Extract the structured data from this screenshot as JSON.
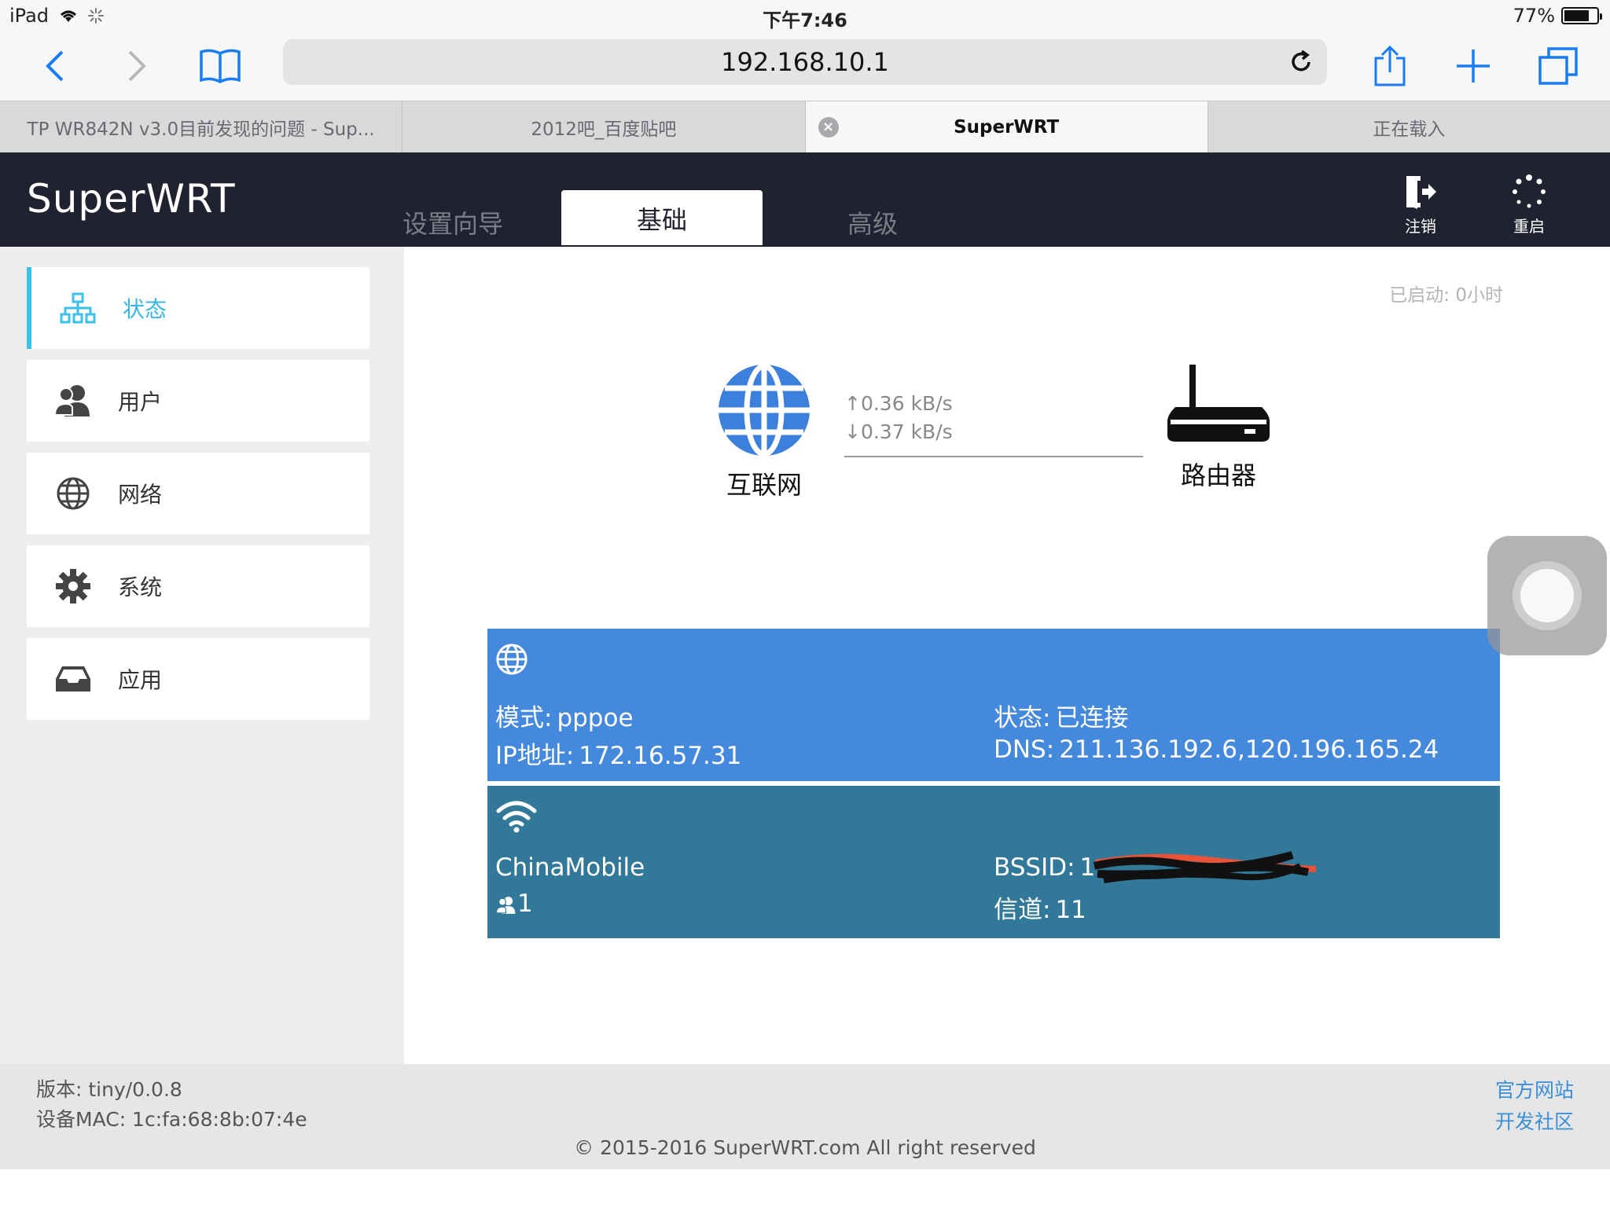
{
  "status_bar": {
    "device": "iPad",
    "time": "下午7:46",
    "battery": "77%",
    "battery_level": 0.77
  },
  "toolbar": {
    "url": "192.168.10.1"
  },
  "tabs": [
    {
      "label": "TP WR842N v3.0目前发现的问题 - Sup..."
    },
    {
      "label": "2012吧_百度贴吧"
    },
    {
      "label": "SuperWRT",
      "active": true
    },
    {
      "label": "正在载入"
    }
  ],
  "header": {
    "brand": "SuperWRT",
    "nav": [
      "设置向导",
      "基础",
      "高级"
    ],
    "logout": "注销",
    "reboot": "重启"
  },
  "sidebar": {
    "items": [
      {
        "label": "状态",
        "icon": "sitemap-icon",
        "active": true
      },
      {
        "label": "用户",
        "icon": "users-icon"
      },
      {
        "label": "网络",
        "icon": "globe-icon"
      },
      {
        "label": "系统",
        "icon": "gear-icon"
      },
      {
        "label": "应用",
        "icon": "inbox-icon"
      }
    ]
  },
  "main": {
    "uptime": "已启动: 0小时",
    "internet_label": "互联网",
    "router_label": "路由器",
    "upload": "0.36 kB/s",
    "download": "0.37 kB/s",
    "wan": {
      "mode_key": "模式:",
      "mode": "pppoe",
      "ip_key": "IP地址:",
      "ip": "172.16.57.31",
      "status_key": "状态:",
      "status": "已连接",
      "dns_key": "DNS:",
      "dns": "211.136.192.6,120.196.165.24"
    },
    "wifi": {
      "ssid": "ChinaMobile",
      "clients": "1",
      "bssid_key": "BSSID:",
      "bssid": "1",
      "channel_key": "信道:",
      "channel": "11"
    }
  },
  "footer": {
    "version": "版本: tiny/0.0.8",
    "mac": "设备MAC: 1c:fa:68:8b:07:4e",
    "link_official": "官方网站",
    "link_community": "开发社区",
    "copyright": "© 2015-2016 SuperWRT.com All right reserved"
  },
  "colors": {
    "header_bg": "#20232f",
    "wan_card": "#4589dc",
    "wifi_card": "#327899",
    "accent": "#3bc0e8",
    "ios_blue": "#1a7cf5"
  }
}
